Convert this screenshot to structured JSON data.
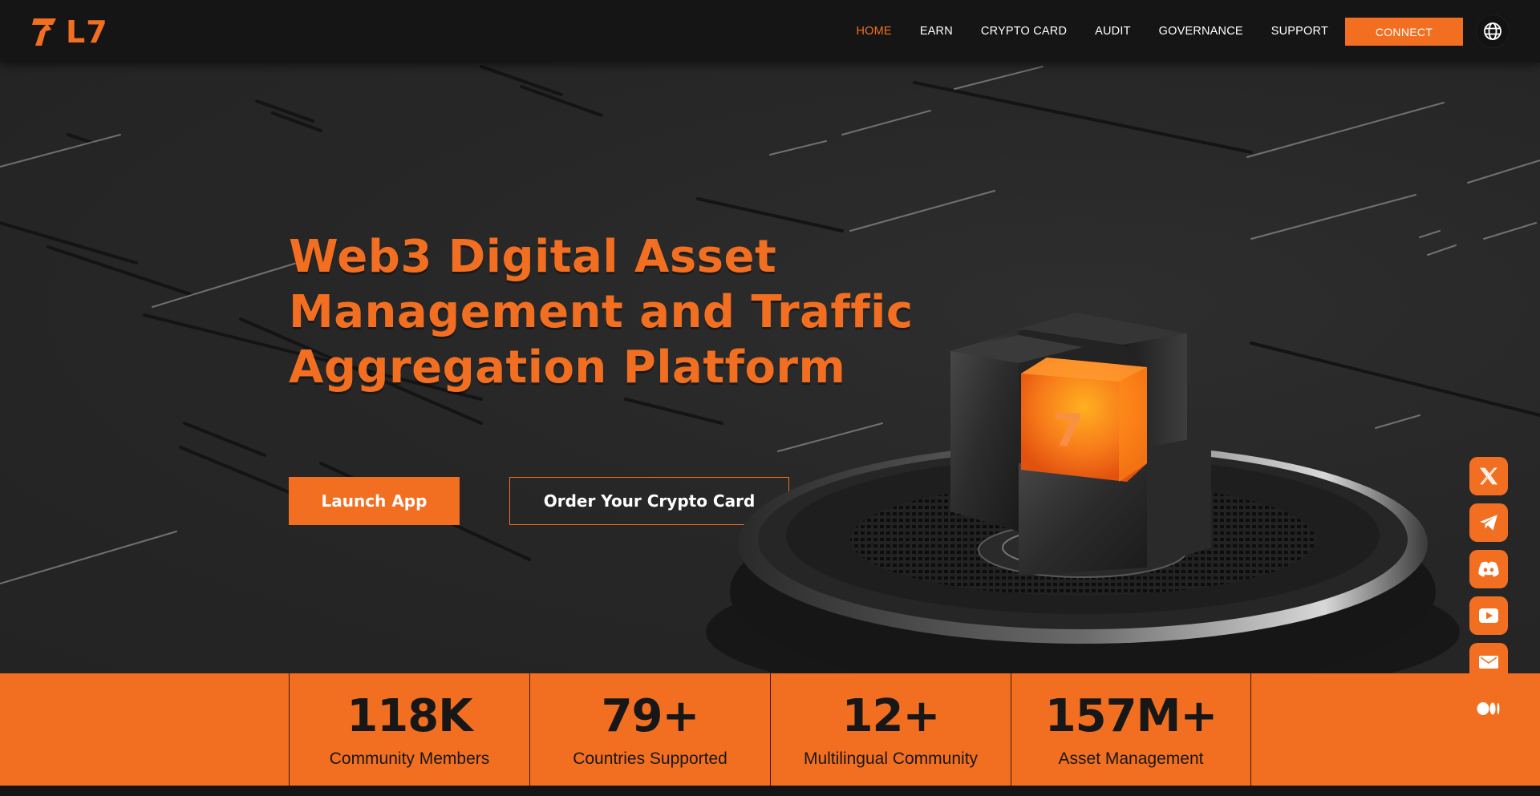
{
  "brand": {
    "logo_text": "L7",
    "logo_mark": "lightning-seven-icon",
    "accent_color": "#f26f21",
    "dark_color": "#151515"
  },
  "nav": {
    "items": [
      {
        "label": "HOME",
        "active": true
      },
      {
        "label": "EARN",
        "active": false
      },
      {
        "label": "CRYPTO CARD",
        "active": false
      },
      {
        "label": "AUDIT",
        "active": false
      },
      {
        "label": "GOVERNANCE",
        "active": false
      },
      {
        "label": "SUPPORT",
        "active": false
      }
    ],
    "connect_label": "CONNECT",
    "language_icon": "globe-icon"
  },
  "hero": {
    "title_lines": [
      "Web3 Digital Asset",
      "Management and Traffic",
      "Aggregation Platform"
    ],
    "primary_button": "Launch App",
    "secondary_button": "Order Your Crypto Card",
    "cube_glyph": "7"
  },
  "social": [
    {
      "name": "x-twitter",
      "icon": "x-icon"
    },
    {
      "name": "telegram",
      "icon": "paper-plane-icon"
    },
    {
      "name": "discord",
      "icon": "discord-icon"
    },
    {
      "name": "youtube",
      "icon": "play-icon"
    },
    {
      "name": "email",
      "icon": "envelope-icon"
    },
    {
      "name": "medium",
      "icon": "medium-icon"
    }
  ],
  "stats": [
    {
      "value": "118K",
      "label": "Community Members"
    },
    {
      "value": "79+",
      "label": "Countries Supported"
    },
    {
      "value": "12+",
      "label": "Multilingual Community"
    },
    {
      "value": "157M+",
      "label": "Asset Management"
    }
  ]
}
